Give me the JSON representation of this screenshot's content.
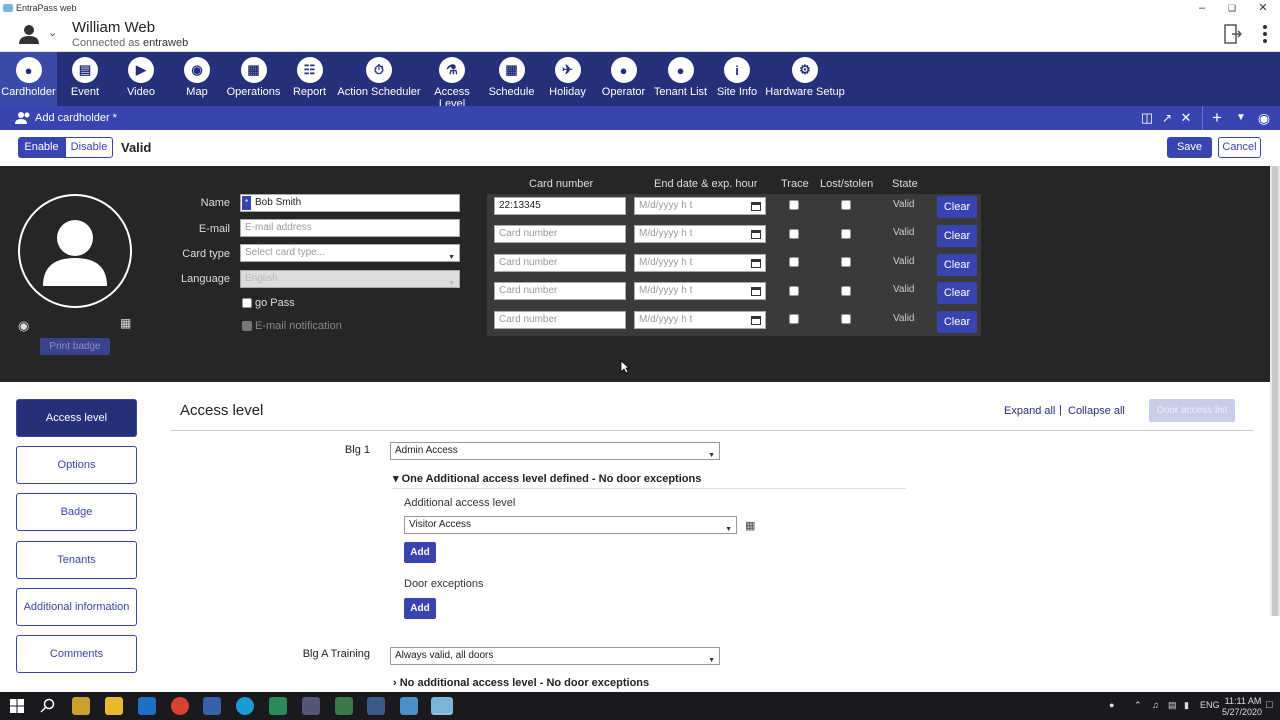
{
  "window": {
    "title": "EntraPass web"
  },
  "user": {
    "name": "William Web",
    "connected_prefix": "Connected as",
    "account": "entraweb"
  },
  "menu": [
    {
      "label": "Cardholder",
      "icon": "person-icon"
    },
    {
      "label": "Event",
      "icon": "clipboard-icon"
    },
    {
      "label": "Video",
      "icon": "video-icon"
    },
    {
      "label": "Map",
      "icon": "map-icon"
    },
    {
      "label": "Operations",
      "icon": "operations-icon"
    },
    {
      "label": "Report",
      "icon": "report-icon"
    },
    {
      "label": "Action Scheduler",
      "icon": "action-scheduler-icon"
    },
    {
      "label": "Access Level",
      "icon": "access-level-icon"
    },
    {
      "label": "Schedule",
      "icon": "calendar-icon"
    },
    {
      "label": "Holiday",
      "icon": "plane-icon"
    },
    {
      "label": "Operator",
      "icon": "operator-icon"
    },
    {
      "label": "Tenant List",
      "icon": "tenant-icon"
    },
    {
      "label": "Site Info",
      "icon": "info-icon"
    },
    {
      "label": "Hardware Setup",
      "icon": "gear-icon"
    }
  ],
  "tab": {
    "title": "Add cardholder *"
  },
  "status": {
    "enable": "Enable",
    "disable": "Disable",
    "state": "Valid",
    "save": "Save",
    "cancel": "Cancel"
  },
  "form": {
    "name_label": "Name",
    "name_value": "Bob Smith",
    "email_label": "E-mail",
    "email_placeholder": "E-mail address",
    "cardtype_label": "Card type",
    "cardtype_placeholder": "Select card type...",
    "language_label": "Language",
    "language_value": "English",
    "gopass": "go Pass",
    "email_notification": "E-mail notification",
    "print_badge": "Print badge"
  },
  "cards": {
    "headers": {
      "card_number": "Card number",
      "end_date": "End date & exp. hour",
      "trace": "Trace",
      "lost": "Lost/stolen",
      "state": "State"
    },
    "rows": [
      {
        "number": "22:13345",
        "number_placeholder": "Card number",
        "date_placeholder": "M/d/yyyy h t",
        "state": "Valid",
        "clear": "Clear"
      },
      {
        "number": "",
        "number_placeholder": "Card number",
        "date_placeholder": "M/d/yyyy h t",
        "state": "Valid",
        "clear": "Clear"
      },
      {
        "number": "",
        "number_placeholder": "Card number",
        "date_placeholder": "M/d/yyyy h t",
        "state": "Valid",
        "clear": "Clear"
      },
      {
        "number": "",
        "number_placeholder": "Card number",
        "date_placeholder": "M/d/yyyy h t",
        "state": "Valid",
        "clear": "Clear"
      },
      {
        "number": "",
        "number_placeholder": "Card number",
        "date_placeholder": "M/d/yyyy h t",
        "state": "Valid",
        "clear": "Clear"
      }
    ]
  },
  "sidenav": [
    "Access level",
    "Options",
    "Badge",
    "Tenants",
    "Additional information",
    "Comments"
  ],
  "access": {
    "title": "Access level",
    "expand_all": "Expand all",
    "separator": "|",
    "collapse_all": "Collapse all",
    "door_access_list": "Door access list",
    "blg1_label": "Blg 1",
    "blg1_value": "Admin Access",
    "blg1_toggle": "One Additional access level defined - No door exceptions",
    "additional_label": "Additional access level",
    "additional_value": "Visitor Access",
    "add": "Add",
    "door_exceptions_label": "Door exceptions",
    "blga_label": "Blg A Training",
    "blga_value": "Always valid, all doors",
    "blga_toggle": "No additional access level - No door exceptions"
  },
  "taskbar": {
    "lang": "ENG",
    "time": "11:11 AM",
    "date": "5/27/2020"
  }
}
